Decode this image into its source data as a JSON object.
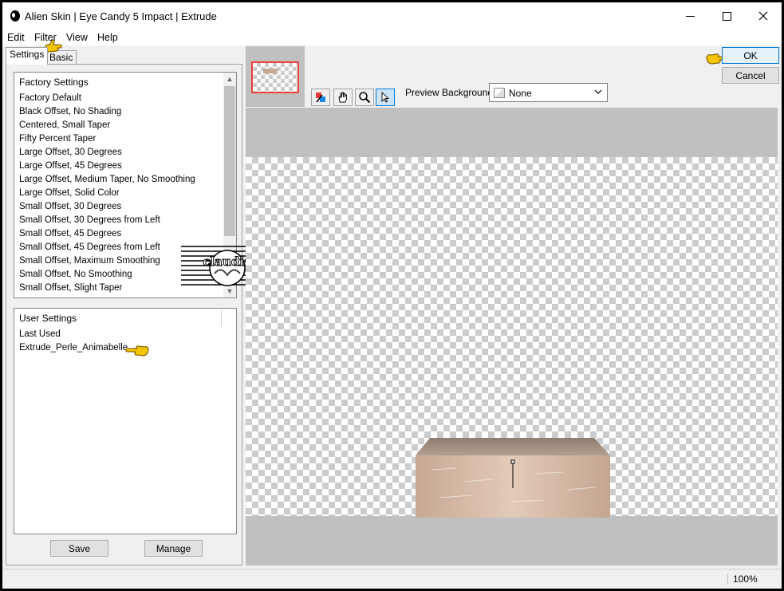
{
  "window": {
    "title": "Alien Skin | Eye Candy 5 Impact | Extrude",
    "minimize_icon": "minimize-icon",
    "maximize_icon": "maximize-icon",
    "close_icon": "close-icon"
  },
  "menu": {
    "items": [
      "Edit",
      "Filter",
      "View",
      "Help"
    ]
  },
  "tabs": [
    "Settings",
    "Basic"
  ],
  "factory_settings": {
    "header": "Factory Settings",
    "items": [
      "Factory Default",
      "Black Offset, No Shading",
      "Centered, Small Taper",
      "Fifty Percent Taper",
      "Large Offset, 30 Degrees",
      "Large Offset, 45 Degrees",
      "Large Offset, Medium Taper, No Smoothing",
      "Large Offset, Solid Color",
      "Small Offset, 30 Degrees",
      "Small Offset, 30 Degrees from Left",
      "Small Offset, 45 Degrees",
      "Small Offset, 45 Degrees from Left",
      "Small Offset, Maximum Smoothing",
      "Small Offset, No Smoothing",
      "Small Offset, Slight Taper"
    ]
  },
  "user_settings": {
    "header": "User Settings",
    "items": [
      "Last Used",
      "Extrude_Perle_Animabelle"
    ]
  },
  "buttons": {
    "save": "Save",
    "manage": "Manage",
    "ok": "OK",
    "cancel": "Cancel"
  },
  "toolbar": {
    "tools": [
      "color-picker-icon",
      "hand-icon",
      "zoom-icon",
      "pointer-icon"
    ],
    "preview_background_label": "Preview Background:",
    "preview_background_value": "None"
  },
  "watermark_text": "claudia",
  "status": {
    "zoom": "100%"
  },
  "colors": {
    "ok_border": "#0078d7",
    "thumb_frame": "#f04040",
    "preview_bg": "#c0c0c0",
    "pointer_hand": "#f5c400"
  }
}
